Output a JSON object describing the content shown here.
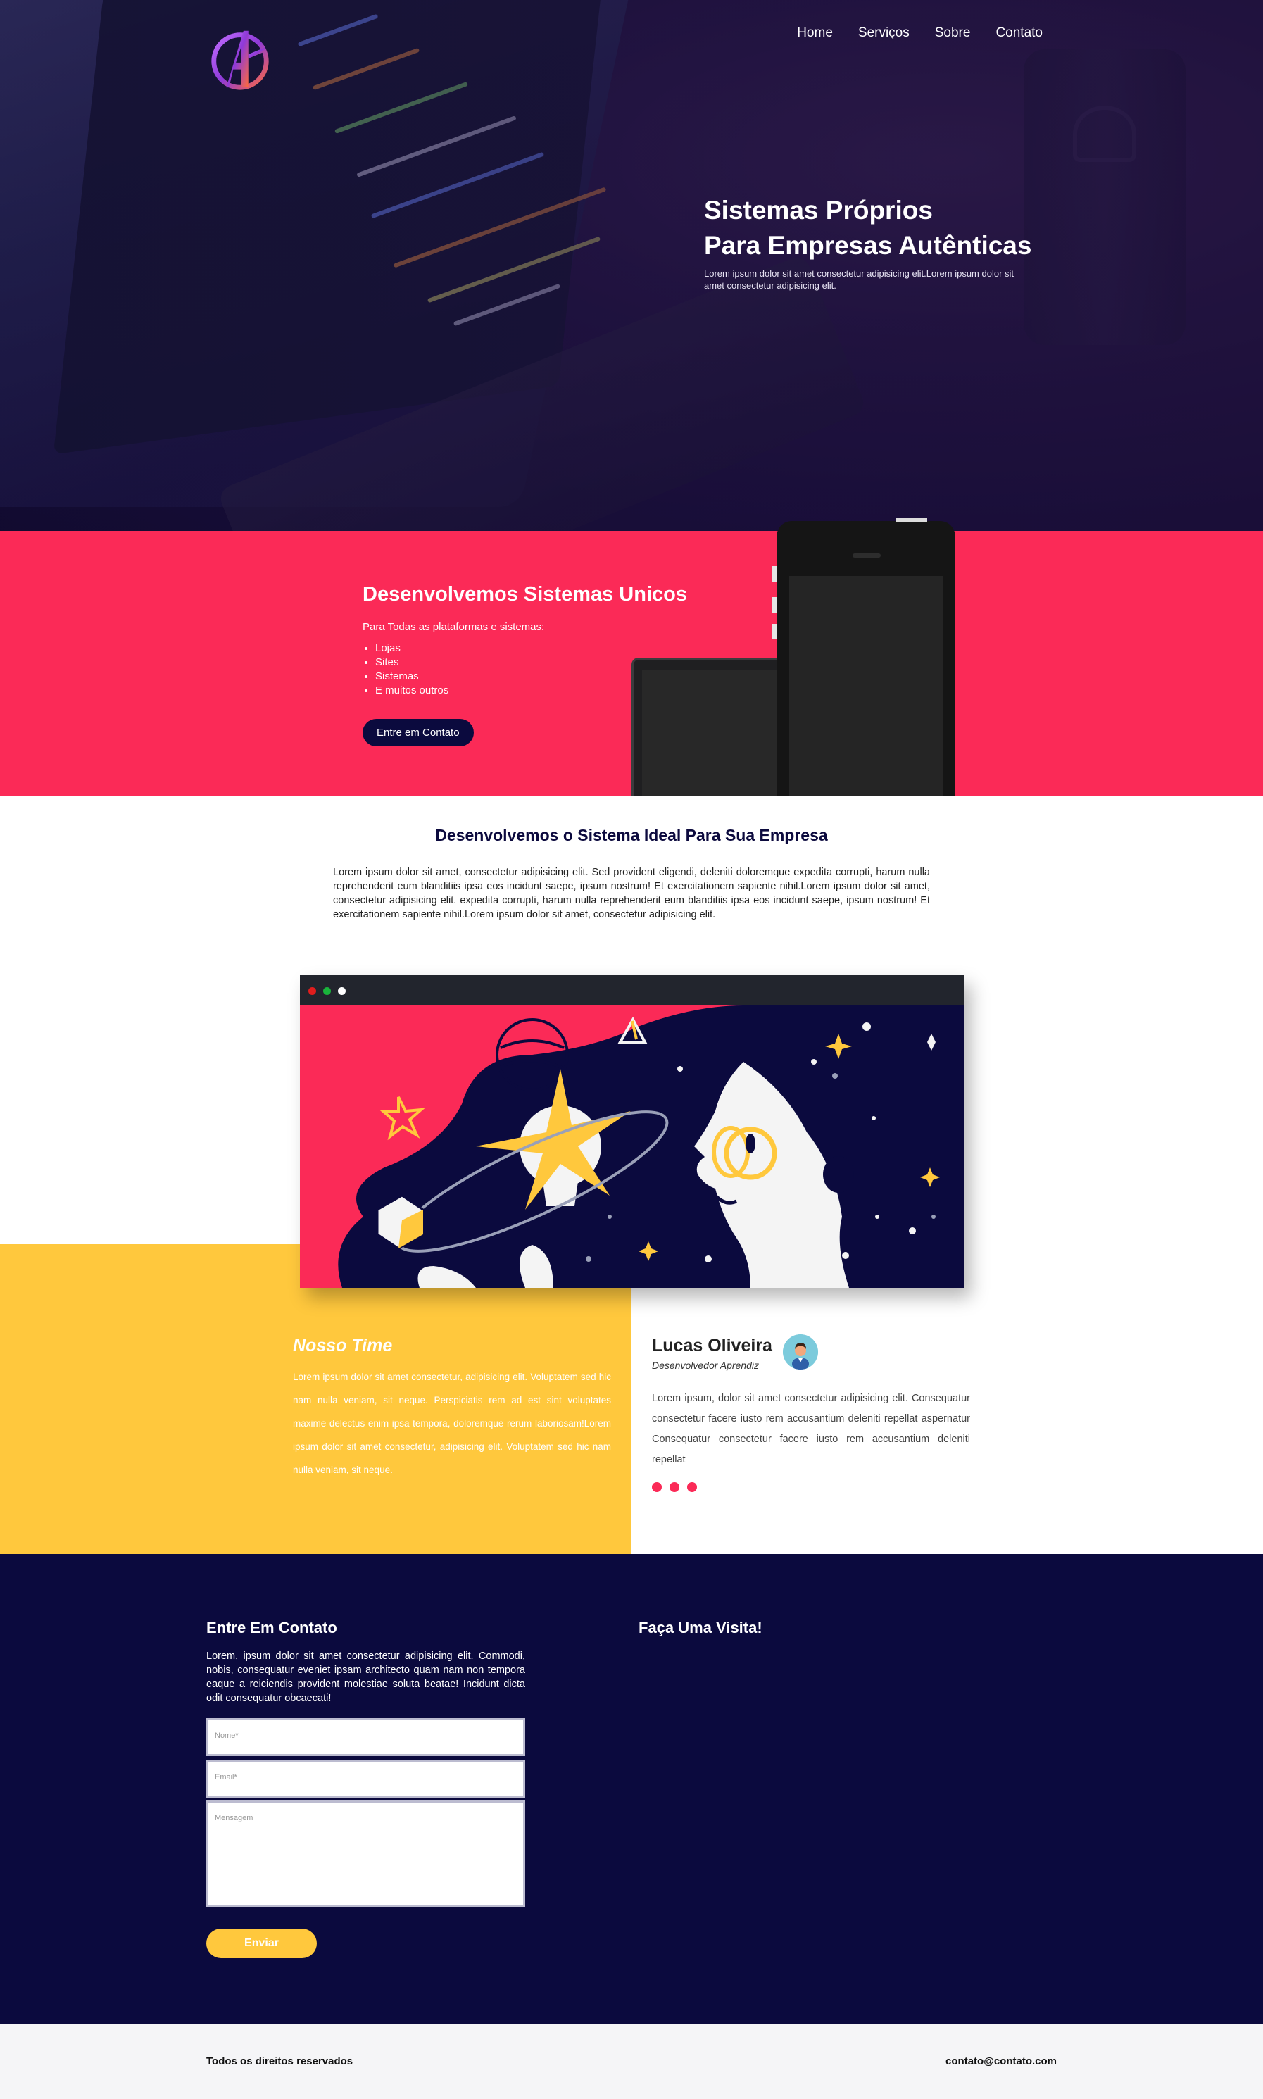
{
  "brand": {
    "logo_icon": "avengers-logo-icon"
  },
  "nav": {
    "items": [
      {
        "label": "Home"
      },
      {
        "label": "Serviços"
      },
      {
        "label": "Sobre"
      },
      {
        "label": "Contato"
      }
    ]
  },
  "hero": {
    "title_line1": "Sistemas Próprios",
    "title_line2": "Para Empresas Autênticas",
    "text": "Lorem ipsum dolor sit amet consectetur adipisicing elit.Lorem ipsum dolor sit amet consectetur adipisicing elit."
  },
  "services": {
    "title": "Desenvolvemos Sistemas Unicos",
    "subtitle": "Para Todas as plataformas e sistemas:",
    "items": [
      "Lojas",
      "Sites",
      "Sistemas",
      "E muitos outros"
    ],
    "cta": "Entre em Contato"
  },
  "ideal": {
    "title": "Desenvolvemos o Sistema Ideal Para Sua Empresa",
    "text": "Lorem ipsum dolor sit amet, consectetur adipisicing elit. Sed provident eligendi, deleniti doloremque expedita corrupti, harum nulla reprehenderit eum blanditiis ipsa eos incidunt saepe, ipsum nostrum! Et exercitationem sapiente nihil.Lorem ipsum dolor sit amet, consectetur adipisicing elit. expedita corrupti, harum nulla reprehenderit eum blanditiis ipsa eos incidunt saepe, ipsum nostrum! Et exercitationem sapiente nihil.Lorem ipsum dolor sit amet, consectetur adipisicing elit."
  },
  "team": {
    "title": "Nosso Time",
    "text": "Lorem ipsum dolor sit amet consectetur, adipisicing elit. Voluptatem sed hic nam nulla veniam, sit neque. Perspiciatis rem ad est sint voluptates maxime delectus enim ipsa tempora, doloremque rerum laboriosam!Lorem ipsum dolor sit amet consectetur, adipisicing elit. Voluptatem sed hic nam nulla veniam, sit neque.",
    "member": {
      "name": "Lucas Oliveira",
      "role": "Desenvolvedor Aprendiz",
      "bio": "Lorem ipsum, dolor sit amet consectetur adipisicing elit. Consequatur consectetur facere iusto rem accusantium deleniti repellat aspernatur Consequatur consectetur facere iusto rem accusantium deleniti repellat"
    },
    "carousel_count": 3
  },
  "contact": {
    "title": "Entre Em Contato",
    "text": "Lorem, ipsum dolor sit amet consectetur adipisicing elit. Commodi, nobis, consequatur eveniet ipsam architecto quam nam non tempora eaque a reiciendis provident molestiae soluta beatae! Incidunt dicta odit consequatur obcaecati!",
    "name_placeholder": "Nome*",
    "email_placeholder": "Email*",
    "message_placeholder": "Mensagem",
    "submit": "Enviar",
    "visit_title": "Faça Uma Visita!"
  },
  "footer": {
    "rights": "Todos os direitos reservados",
    "email": "contato@contato.com"
  },
  "colors": {
    "pink": "#fb2a57",
    "navy": "#0b0a3e",
    "yellow": "#ffc83d"
  }
}
